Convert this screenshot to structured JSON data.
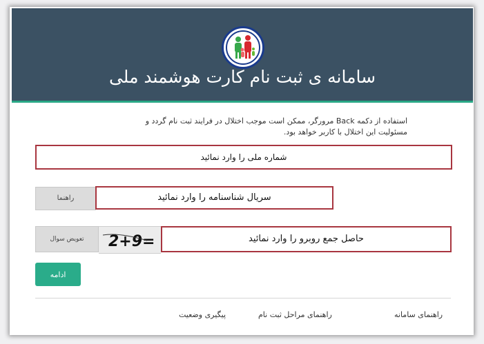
{
  "header": {
    "title": "سامانه ی ثبت نام کارت هوشمند ملی",
    "logo_icon": "family-emblem-icon"
  },
  "notice": "استفاده از دکمه Back مرورگر، ممکن است موجب اختلال در فرایند ثبت نام گردد و مسئولیت این اختلال با کاربر خواهد بود.",
  "form": {
    "national_id_placeholder": "شماره ملی را وارد نمائید",
    "serial_placeholder": "سریال شناسنامه را وارد نمائید",
    "help_label": "راهنما",
    "captcha_placeholder": "حاصل جمع روبرو را وارد نمائید",
    "captcha_text": "2+9=",
    "change_question_label": "تعویض سوال",
    "continue_label": "ادامه"
  },
  "footer": {
    "links": [
      "راهنمای سامانه",
      "راهنمای مراحل ثبت نام",
      "پیگیری وضعیت"
    ]
  },
  "colors": {
    "header_bg": "#3b5163",
    "accent": "#2aac8a",
    "field_border": "#a8353f"
  }
}
